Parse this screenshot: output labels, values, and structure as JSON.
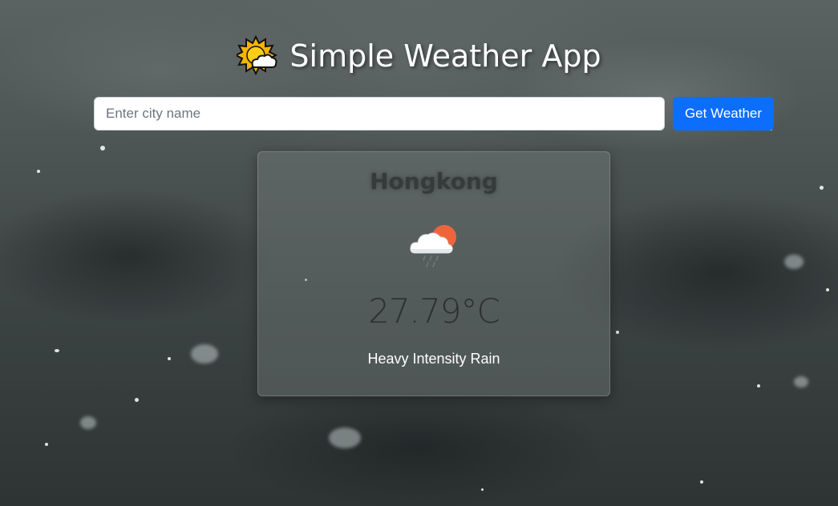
{
  "header": {
    "title": "Simple Weather App",
    "icon": "sun-behind-cloud-icon"
  },
  "search": {
    "placeholder": "Enter city name",
    "value": "",
    "button_label": "Get Weather"
  },
  "weather": {
    "city": "Hongkong",
    "icon": "cloud-sun-rain-icon",
    "temperature": "27.79°C",
    "description": "Heavy Intensity Rain"
  },
  "colors": {
    "button": "#0d6efd",
    "background": "#4a5251"
  }
}
